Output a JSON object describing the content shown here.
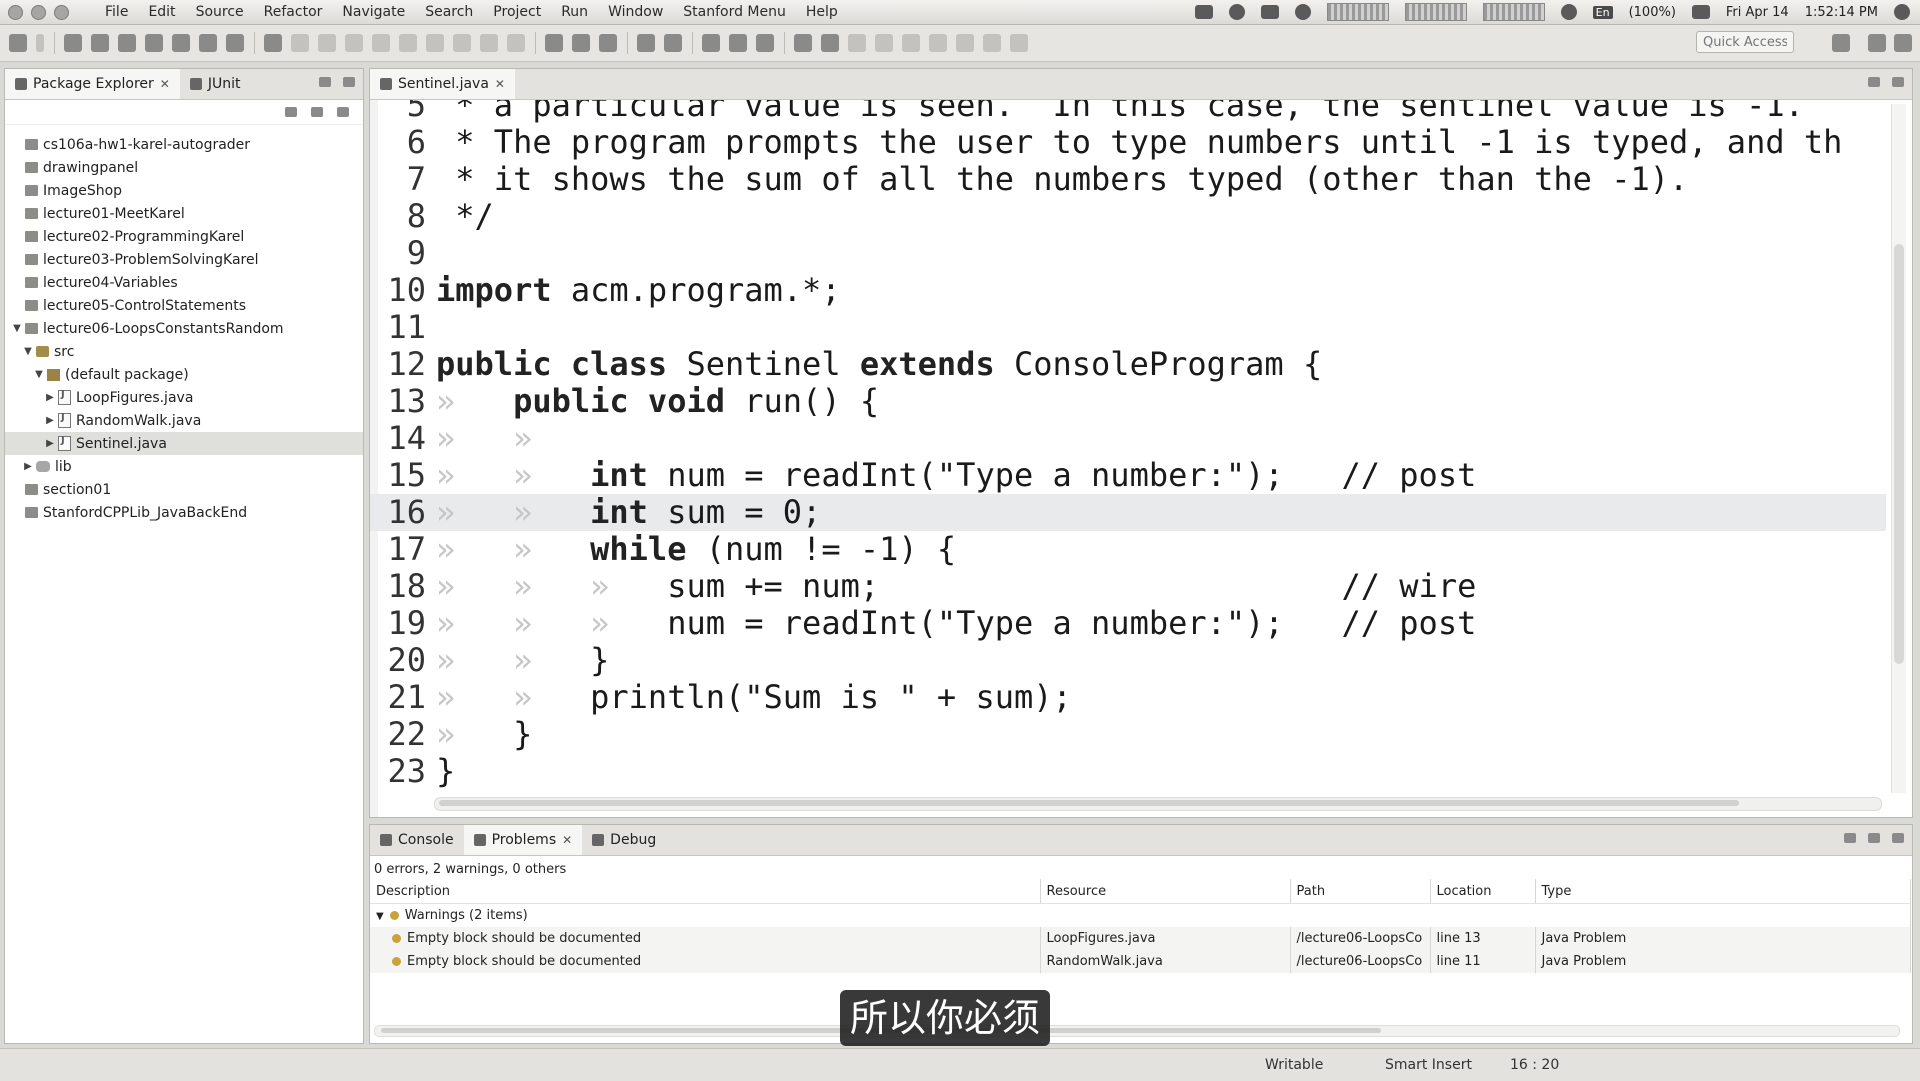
{
  "menubar": {
    "items": [
      "File",
      "Edit",
      "Source",
      "Refactor",
      "Navigate",
      "Search",
      "Project",
      "Run",
      "Window",
      "Stanford Menu",
      "Help"
    ],
    "keyboard": "En",
    "battery": "(100%)",
    "date": "Fri Apr 14",
    "time": "1:52:14 PM"
  },
  "toolbar": {
    "quick_access_placeholder": "Quick Access"
  },
  "explorer": {
    "tab_label": "Package Explorer",
    "second_tab_label": "JUnit",
    "tree": [
      {
        "label": "cs106a-hw1-karel-autograder",
        "level": 0,
        "twisty": "",
        "icon": "project"
      },
      {
        "label": "drawingpanel",
        "level": 0,
        "twisty": "",
        "icon": "project"
      },
      {
        "label": "ImageShop",
        "level": 0,
        "twisty": "",
        "icon": "project"
      },
      {
        "label": "lecture01-MeetKarel",
        "level": 0,
        "twisty": "",
        "icon": "project"
      },
      {
        "label": "lecture02-ProgrammingKarel",
        "level": 0,
        "twisty": "",
        "icon": "project"
      },
      {
        "label": "lecture03-ProblemSolvingKarel",
        "level": 0,
        "twisty": "",
        "icon": "project"
      },
      {
        "label": "lecture04-Variables",
        "level": 0,
        "twisty": "",
        "icon": "project"
      },
      {
        "label": "lecture05-ControlStatements",
        "level": 0,
        "twisty": "",
        "icon": "project"
      },
      {
        "label": "lecture06-LoopsConstantsRandom",
        "level": 0,
        "twisty": "▼",
        "icon": "project"
      },
      {
        "label": "src",
        "level": 1,
        "twisty": "▼",
        "icon": "src"
      },
      {
        "label": "(default package)",
        "level": 2,
        "twisty": "▼",
        "icon": "package"
      },
      {
        "label": "LoopFigures.java",
        "level": 3,
        "twisty": "▶",
        "icon": "java"
      },
      {
        "label": "RandomWalk.java",
        "level": 3,
        "twisty": "▶",
        "icon": "java"
      },
      {
        "label": "Sentinel.java",
        "level": 3,
        "twisty": "▶",
        "icon": "java",
        "selected": true
      },
      {
        "label": "lib",
        "level": 1,
        "twisty": "▶",
        "icon": "lib"
      },
      {
        "label": "section01",
        "level": 0,
        "twisty": "",
        "icon": "project"
      },
      {
        "label": "StanfordCPPLib_JavaBackEnd",
        "level": 0,
        "twisty": "",
        "icon": "project"
      }
    ]
  },
  "editor": {
    "tab_label": "Sentinel.java",
    "current_line": 16,
    "lines": [
      {
        "n": "5",
        "indent": 0,
        "segments": [
          {
            "t": " * a particular value is seen.  In this case, the sentinel value is -1."
          }
        ]
      },
      {
        "n": "6",
        "indent": 0,
        "segments": [
          {
            "t": " * The program prompts the user to type numbers until -1 is typed, and th"
          }
        ]
      },
      {
        "n": "7",
        "indent": 0,
        "segments": [
          {
            "t": " * it shows the sum of all the numbers typed (other than the -1)."
          }
        ]
      },
      {
        "n": "8",
        "indent": 0,
        "segments": [
          {
            "t": " */"
          }
        ]
      },
      {
        "n": "9",
        "indent": 0,
        "segments": []
      },
      {
        "n": "10",
        "indent": 0,
        "segments": [
          {
            "t": "import",
            "kw": true
          },
          {
            "t": " acm.program.*;"
          }
        ]
      },
      {
        "n": "11",
        "indent": 0,
        "segments": []
      },
      {
        "n": "12",
        "indent": 0,
        "segments": [
          {
            "t": "public",
            "kw": true
          },
          {
            "t": " "
          },
          {
            "t": "class",
            "kw": true
          },
          {
            "t": " Sentinel "
          },
          {
            "t": "extends",
            "kw": true
          },
          {
            "t": " ConsoleProgram {"
          }
        ]
      },
      {
        "n": "13",
        "indent": 1,
        "segments": [
          {
            "t": "public",
            "kw": true
          },
          {
            "t": " "
          },
          {
            "t": "void",
            "kw": true
          },
          {
            "t": " run() {"
          }
        ]
      },
      {
        "n": "14",
        "indent": 2,
        "segments": []
      },
      {
        "n": "15",
        "indent": 2,
        "segments": [
          {
            "t": "int",
            "kw": true
          },
          {
            "t": " num = readInt(\"Type a number:\");   // post"
          }
        ]
      },
      {
        "n": "16",
        "indent": 2,
        "segments": [
          {
            "t": "int",
            "kw": true
          },
          {
            "t": " sum = 0;"
          }
        ]
      },
      {
        "n": "17",
        "indent": 2,
        "segments": [
          {
            "t": "while",
            "kw": true
          },
          {
            "t": " (num != -1) {"
          }
        ]
      },
      {
        "n": "18",
        "indent": 3,
        "segments": [
          {
            "t": "sum += num;                        // wire"
          }
        ]
      },
      {
        "n": "19",
        "indent": 3,
        "segments": [
          {
            "t": "num = readInt(\"Type a number:\");   // post"
          }
        ]
      },
      {
        "n": "20",
        "indent": 2,
        "segments": [
          {
            "t": "}"
          }
        ]
      },
      {
        "n": "21",
        "indent": 2,
        "segments": [
          {
            "t": "println(\"Sum is \" + sum);"
          }
        ]
      },
      {
        "n": "22",
        "indent": 1,
        "segments": [
          {
            "t": "}"
          }
        ]
      },
      {
        "n": "23",
        "indent": 0,
        "segments": [
          {
            "t": "}"
          }
        ]
      }
    ]
  },
  "problems": {
    "tabs": [
      "Console",
      "Problems",
      "Debug"
    ],
    "active_tab": "Problems",
    "summary": "0 errors, 2 warnings, 0 others",
    "columns": [
      "Description",
      "Resource",
      "Path",
      "Location",
      "Type"
    ],
    "group_label": "Warnings (2 items)",
    "rows": [
      {
        "description": "Empty block should be documented",
        "resource": "LoopFigures.java",
        "path": "/lecture06-LoopsCo",
        "location": "line 13",
        "type": "Java Problem"
      },
      {
        "description": "Empty block should be documented",
        "resource": "RandomWalk.java",
        "path": "/lecture06-LoopsCo",
        "location": "line 11",
        "type": "Java Problem"
      }
    ]
  },
  "subtitle": "所以你必须",
  "statusbar": {
    "mode": "Writable",
    "insert": "Smart Insert",
    "position": "16 : 20"
  }
}
